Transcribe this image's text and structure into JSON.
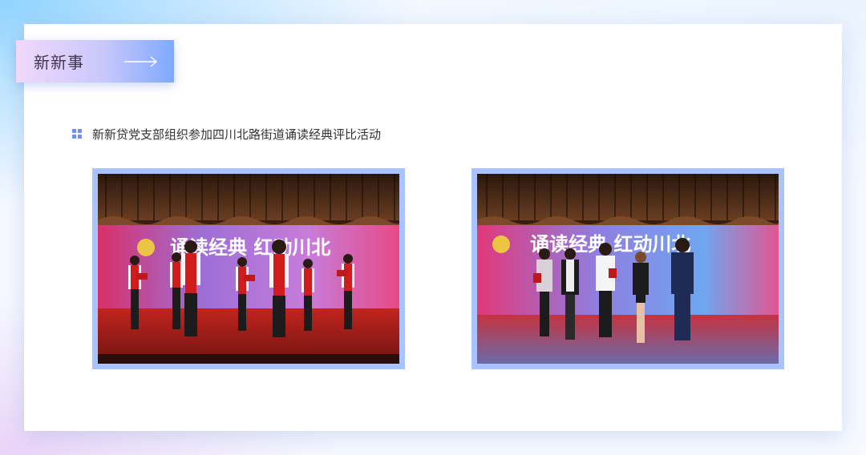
{
  "section": {
    "title": "新新事",
    "arrow_icon": "long-arrow-right-icon"
  },
  "article": {
    "bullet_icon": "grid-bullet-icon",
    "headline": "新新贷党支部组织参加四川北路街道诵读经典评比活动"
  },
  "photos": [
    {
      "name": "reading-performance-photo",
      "banner_text": "诵读经典 红动川北"
    },
    {
      "name": "award-ceremony-photo",
      "banner_text": "诵读经典 红动川北"
    }
  ],
  "colors": {
    "frame": "#a9c3ff",
    "accent": "#6e8ff0",
    "headline_text": "#333333"
  }
}
